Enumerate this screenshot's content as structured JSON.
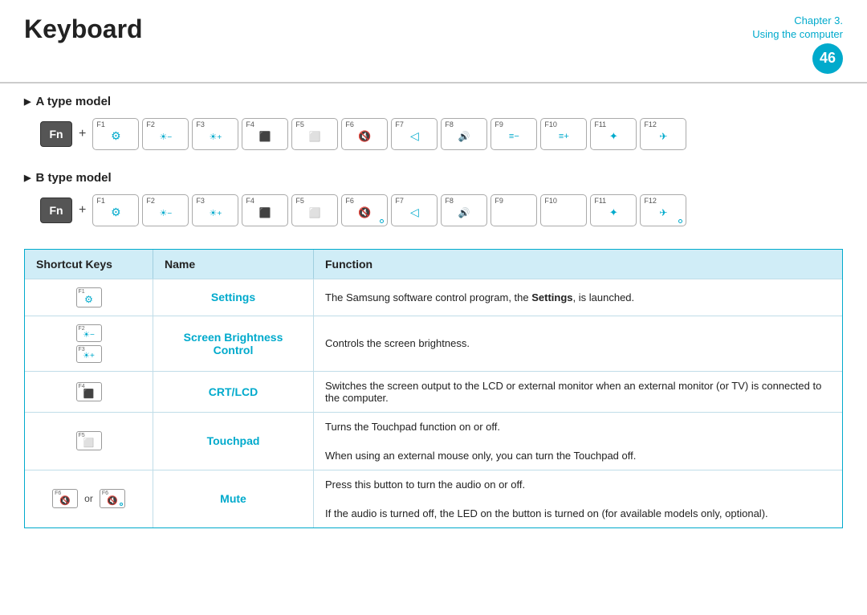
{
  "header": {
    "title": "Keyboard",
    "chapter_line1": "Chapter 3.",
    "chapter_line2": "Using the computer",
    "page_number": "46"
  },
  "sections": {
    "a_type": {
      "label": "A type model"
    },
    "b_type": {
      "label": "B type model"
    }
  },
  "fn_key_label": "Fn",
  "plus": "+",
  "fkeys_a": [
    {
      "num": "F1",
      "icon": "⚙",
      "dot": false
    },
    {
      "num": "F2",
      "icon": "☀−",
      "dot": false
    },
    {
      "num": "F3",
      "icon": "☀+",
      "dot": false
    },
    {
      "num": "F4",
      "icon": "⬛▷",
      "dot": false
    },
    {
      "num": "F5",
      "icon": "⬜✕",
      "dot": false
    },
    {
      "num": "F6",
      "icon": "🔇",
      "dot": false
    },
    {
      "num": "F7",
      "icon": "◁",
      "dot": false
    },
    {
      "num": "F8",
      "icon": "◁)",
      "dot": false
    },
    {
      "num": "F9",
      "icon": "≡−",
      "dot": false
    },
    {
      "num": "F10",
      "icon": "≡+",
      "dot": false
    },
    {
      "num": "F11",
      "icon": "✦",
      "dot": false
    },
    {
      "num": "F12",
      "icon": "✈",
      "dot": false
    }
  ],
  "fkeys_b": [
    {
      "num": "F1",
      "icon": "⚙",
      "dot": false
    },
    {
      "num": "F2",
      "icon": "☀−",
      "dot": false
    },
    {
      "num": "F3",
      "icon": "☀+",
      "dot": false
    },
    {
      "num": "F4",
      "icon": "⬛▷",
      "dot": false
    },
    {
      "num": "F5",
      "icon": "⬜✕",
      "dot": false
    },
    {
      "num": "F6",
      "icon": "🔇",
      "dot": true
    },
    {
      "num": "F7",
      "icon": "◁",
      "dot": false
    },
    {
      "num": "F8",
      "icon": "◁)",
      "dot": false
    },
    {
      "num": "F9",
      "icon": "",
      "dot": false
    },
    {
      "num": "F10",
      "icon": "",
      "dot": false
    },
    {
      "num": "F11",
      "icon": "✦",
      "dot": false
    },
    {
      "num": "F12",
      "icon": "✈",
      "dot": true
    }
  ],
  "table": {
    "headers": [
      "Shortcut Keys",
      "Name",
      "Function"
    ],
    "rows": [
      {
        "keys": [
          {
            "num": "F1",
            "icon": "⚙",
            "dot": false
          }
        ],
        "name": "Settings",
        "function": [
          "The Samsung software control program, the ",
          "Settings",
          ", is launched."
        ]
      },
      {
        "keys": [
          {
            "num": "F2",
            "icon": "☀−",
            "dot": false
          },
          {
            "num": "F3",
            "icon": "☀+",
            "dot": false
          }
        ],
        "name": "Screen Brightness Control",
        "function": [
          "Controls the screen brightness."
        ]
      },
      {
        "keys": [
          {
            "num": "F4",
            "icon": "▣",
            "dot": false
          }
        ],
        "name": "CRT/LCD",
        "function": [
          "Switches the screen output to the LCD or external monitor when an external monitor (or TV) is connected to the computer."
        ]
      },
      {
        "keys": [
          {
            "num": "F5",
            "icon": "⬜✕",
            "dot": false
          }
        ],
        "name": "Touchpad",
        "function": [
          "Turns the Touchpad function on or off.",
          "When using an external mouse only, you can turn the Touchpad off."
        ]
      },
      {
        "keys_special": true,
        "key1": {
          "num": "F6",
          "icon": "🔇",
          "dot": false
        },
        "key2": {
          "num": "F6",
          "icon": "🔇",
          "dot": true
        },
        "name": "Mute",
        "function": [
          "Press this button to turn the audio on or off.",
          "If the audio is turned off, the LED on the button is turned on (for available models only, optional)."
        ]
      }
    ]
  }
}
